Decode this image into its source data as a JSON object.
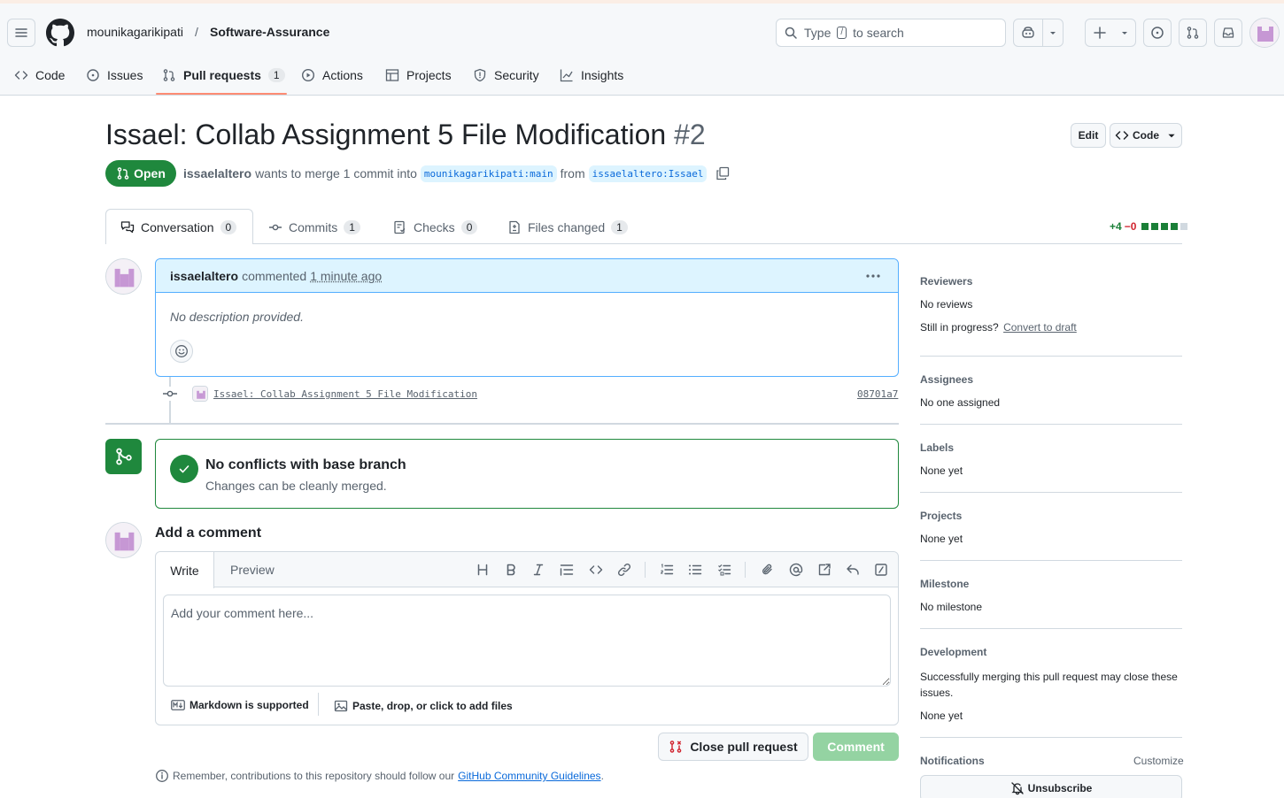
{
  "header": {
    "owner": "mounikagarikipati",
    "separator": "/",
    "repo": "Software-Assurance",
    "search": {
      "prefix": "Type",
      "key": "/",
      "suffix": "to search"
    }
  },
  "repo_nav": {
    "tabs": [
      {
        "label": "Code"
      },
      {
        "label": "Issues"
      },
      {
        "label": "Pull requests",
        "count": "1"
      },
      {
        "label": "Actions"
      },
      {
        "label": "Projects"
      },
      {
        "label": "Security"
      },
      {
        "label": "Insights"
      }
    ]
  },
  "pr": {
    "title": "Issael: Collab Assignment 5 File Modification",
    "number": "#2",
    "edit_label": "Edit",
    "code_label": "Code",
    "state": "Open",
    "author": "issaelaltero",
    "merge_text": "wants to merge 1 commit into",
    "base_branch": "mounikagarikipati:main",
    "from_text": "from",
    "head_branch": "issaelaltero:Issael"
  },
  "pr_tabs": [
    {
      "label": "Conversation",
      "count": "0"
    },
    {
      "label": "Commits",
      "count": "1"
    },
    {
      "label": "Checks",
      "count": "0"
    },
    {
      "label": "Files changed",
      "count": "1"
    }
  ],
  "diffstat": {
    "additions": "+4",
    "deletions": "−0",
    "blocks_added": 4,
    "blocks_total": 5
  },
  "comment": {
    "author": "issaelaltero",
    "action": "commented",
    "time": "1 minute ago",
    "body": "No description provided."
  },
  "commit": {
    "message": "Issael: Collab Assignment 5 File Modification",
    "sha": "08701a7"
  },
  "merge_status": {
    "title": "No conflicts with base branch",
    "subtitle": "Changes can be cleanly merged."
  },
  "add_comment": {
    "heading": "Add a comment",
    "write_tab": "Write",
    "preview_tab": "Preview",
    "placeholder": "Add your comment here...",
    "markdown_note": "Markdown is supported",
    "files_note": "Paste, drop, or click to add files",
    "close_label": "Close pull request",
    "comment_label": "Comment",
    "guidelines_prefix": "Remember, contributions to this repository should follow our",
    "guidelines_link": "GitHub Community Guidelines",
    "guidelines_suffix": "."
  },
  "sidebar": {
    "reviewers": {
      "title": "Reviewers",
      "value": "No reviews",
      "progress": "Still in progress?",
      "draft_link": "Convert to draft"
    },
    "assignees": {
      "title": "Assignees",
      "value": "No one assigned"
    },
    "labels": {
      "title": "Labels",
      "value": "None yet"
    },
    "projects": {
      "title": "Projects",
      "value": "None yet"
    },
    "milestone": {
      "title": "Milestone",
      "value": "No milestone"
    },
    "development": {
      "title": "Development",
      "desc": "Successfully merging this pull request may close these issues.",
      "value": "None yet"
    },
    "notifications": {
      "title": "Notifications",
      "customize": "Customize",
      "unsubscribe": "Unsubscribe"
    }
  },
  "colors": {
    "accent_green": "#1f883d",
    "link_blue": "#0969da",
    "tab_underline": "#fd8c73",
    "comment_header": "#ddf4ff"
  }
}
